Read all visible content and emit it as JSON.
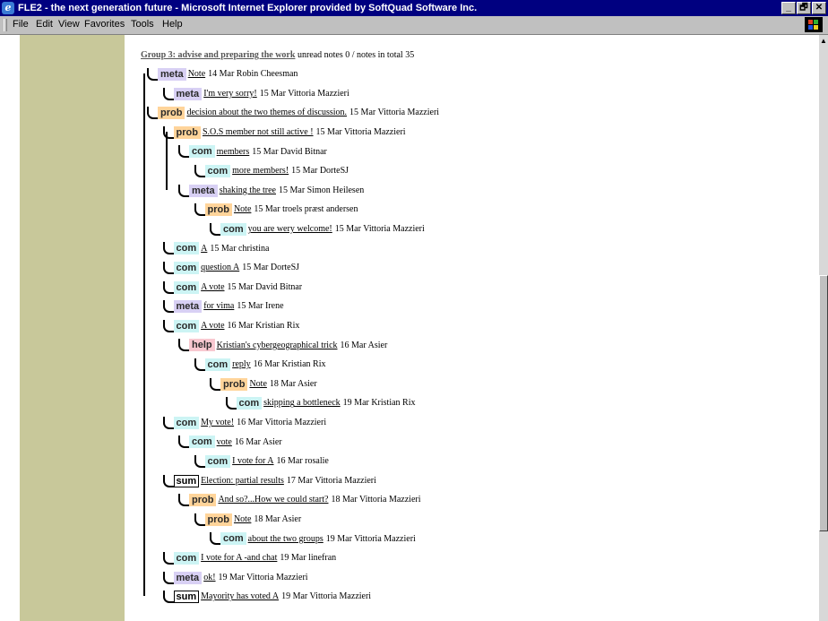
{
  "window": {
    "title": "FLE2 - the next generation future - Microsoft Internet Explorer provided by SoftQuad Software Inc.",
    "buttons": [
      "_",
      "🗗",
      "✕"
    ]
  },
  "menu": [
    "File",
    "Edit",
    "View",
    "Favorites",
    "Tools",
    "Help"
  ],
  "group": {
    "link": "Group 3: advise and preparing the work",
    "status": "unread notes 0 / notes in total 35"
  },
  "notes": [
    {
      "type": "meta",
      "title": "Note",
      "info": "14 Mar Robin Cheesman"
    },
    {
      "type": "meta",
      "title": "I'm very sorry!",
      "info": "15 Mar Vittoria Mazzieri"
    },
    {
      "type": "prob",
      "title": "decision about the two themes of discussion.",
      "info": "15 Mar Vittoria Mazzieri"
    },
    {
      "type": "prob",
      "title": "S.O.S member not still active !",
      "info": "15 Mar Vittoria Mazzieri"
    },
    {
      "type": "com",
      "title": "members",
      "info": "15 Mar David Bitnar"
    },
    {
      "type": "com",
      "title": "more members!",
      "info": "15 Mar DorteSJ"
    },
    {
      "type": "meta",
      "title": "shaking the tree",
      "info": "15 Mar Simon Heilesen"
    },
    {
      "type": "prob",
      "title": "Note",
      "info": "15 Mar troels præst andersen"
    },
    {
      "type": "com",
      "title": "you are wery welcome!",
      "info": "15 Mar Vittoria Mazzieri"
    },
    {
      "type": "com",
      "title": "A",
      "info": "15 Mar christina"
    },
    {
      "type": "com",
      "title": "question A",
      "info": "15 Mar DorteSJ"
    },
    {
      "type": "com",
      "title": "A vote",
      "info": "15 Mar David Bitnar"
    },
    {
      "type": "meta",
      "title": "for vima",
      "info": "15 Mar Irene"
    },
    {
      "type": "com",
      "title": "A vote",
      "info": "16 Mar Kristian Rix"
    },
    {
      "type": "help",
      "title": "Kristian's cybergeographical trick",
      "info": "16 Mar Asier"
    },
    {
      "type": "com",
      "title": "reply",
      "info": "16 Mar Kristian Rix"
    },
    {
      "type": "prob",
      "title": "Note",
      "info": "18 Mar Asier"
    },
    {
      "type": "com",
      "title": "skipping a bottleneck",
      "info": "19 Mar Kristian Rix"
    },
    {
      "type": "com",
      "title": "My vote!",
      "info": "16 Mar Vittoria Mazzieri"
    },
    {
      "type": "com",
      "title": "vote",
      "info": "16 Mar Asier"
    },
    {
      "type": "com",
      "title": "I vote for A",
      "info": "16 Mar rosalie"
    },
    {
      "type": "sum",
      "title": "Election: partial results",
      "info": "17 Mar Vittoria Mazzieri"
    },
    {
      "type": "prob",
      "title": "And so?...How we could start?",
      "info": "18 Mar Vittoria Mazzieri"
    },
    {
      "type": "prob",
      "title": "Note",
      "info": "18 Mar Asier"
    },
    {
      "type": "com",
      "title": "about the two groups",
      "info": "19 Mar Vittoria Mazzieri"
    },
    {
      "type": "com",
      "title": "I vote for A -and chat",
      "info": "19 Mar linefran"
    },
    {
      "type": "meta",
      "title": "ok!",
      "info": "19 Mar Vittoria Mazzieri"
    },
    {
      "type": "sum",
      "title": "Mayority has voted A",
      "info": "19 Mar Vittoria Mazzieri"
    }
  ]
}
